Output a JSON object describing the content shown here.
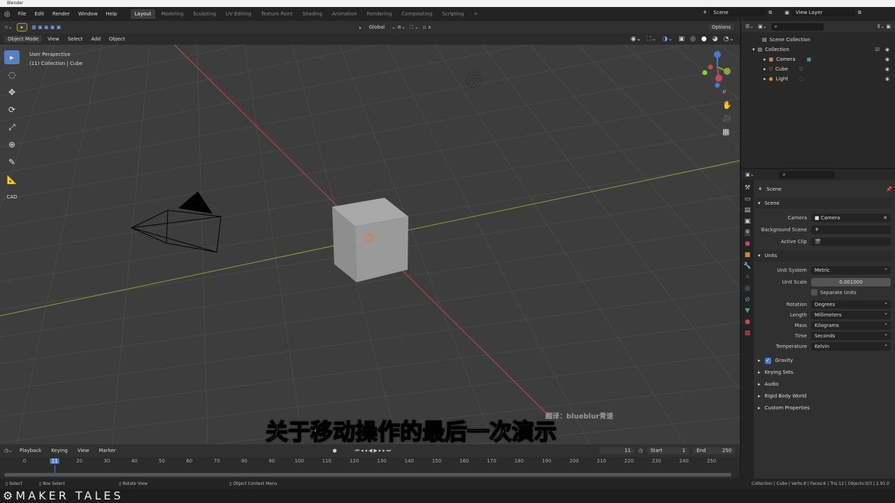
{
  "window": {
    "title": "Blender"
  },
  "menu": [
    "File",
    "Edit",
    "Render",
    "Window",
    "Help"
  ],
  "workspaces": [
    "Layout",
    "Modeling",
    "Sculpting",
    "UV Editing",
    "Texture Paint",
    "Shading",
    "Animation",
    "Rendering",
    "Compositing",
    "Scripting",
    "+"
  ],
  "scene": {
    "name": "Scene",
    "view_layer": "View Layer"
  },
  "toolheader": {
    "orientation": "Global",
    "options": "Options"
  },
  "viewport_header": {
    "mode": "Object Mode",
    "menus": [
      "View",
      "Select",
      "Add",
      "Object"
    ]
  },
  "viewport": {
    "perspective": "User Perspective",
    "collection": "(11) Collection | Cube"
  },
  "outliner": {
    "root": "Scene Collection",
    "collection": "Collection",
    "items": [
      "Camera",
      "Cube",
      "Light"
    ]
  },
  "properties": {
    "context": "Scene",
    "section_scene": "Scene",
    "camera_label": "Camera",
    "camera_value": "Camera",
    "bg_label": "Background Scene",
    "clip_label": "Active Clip",
    "section_units": "Units",
    "rows": [
      {
        "label": "Unit System",
        "value": "Metric"
      },
      {
        "label": "Unit Scale",
        "value": "0.001000"
      },
      {
        "label": "",
        "value": "Separate Units"
      },
      {
        "label": "Rotation",
        "value": "Degrees"
      },
      {
        "label": "Length",
        "value": "Millimeters"
      },
      {
        "label": "Mass",
        "value": "Kilograms"
      },
      {
        "label": "Time",
        "value": "Seconds"
      },
      {
        "label": "Temperature",
        "value": "Kelvin"
      }
    ],
    "collapsed": [
      "Gravity",
      "Keying Sets",
      "Audio",
      "Rigid Body World",
      "Custom Properties"
    ]
  },
  "timeline": {
    "menus": [
      "Playback",
      "Keying",
      "View",
      "Marker"
    ],
    "current_frame": "11",
    "start_label": "Start",
    "start": "1",
    "end_label": "End",
    "end": "250",
    "ticks": [
      "0",
      "11",
      "20",
      "30",
      "40",
      "50",
      "60",
      "70",
      "80",
      "90",
      "100",
      "110",
      "120",
      "130",
      "140",
      "150",
      "160",
      "170",
      "180",
      "190",
      "200",
      "210",
      "220",
      "230",
      "240",
      "250"
    ]
  },
  "status": {
    "select": "Select",
    "box_select": "Box Select",
    "rotate": "Rotate View",
    "context_menu": "Object Context Menu",
    "stats": "Collection | Cube | Verts:8 | Faces:6 | Tris:12 | Objects:0/3 | 2.91.0"
  },
  "overlay": {
    "subtitle": "关于移动操作的最后一次演示",
    "credit": "翻译：blueblur青速",
    "brand": "MAKER TALES"
  },
  "colors": {
    "accent": "#5680c2",
    "x_axis": "#c04a55",
    "y_axis": "#8aa43a",
    "bg": "#3d3d3d"
  }
}
